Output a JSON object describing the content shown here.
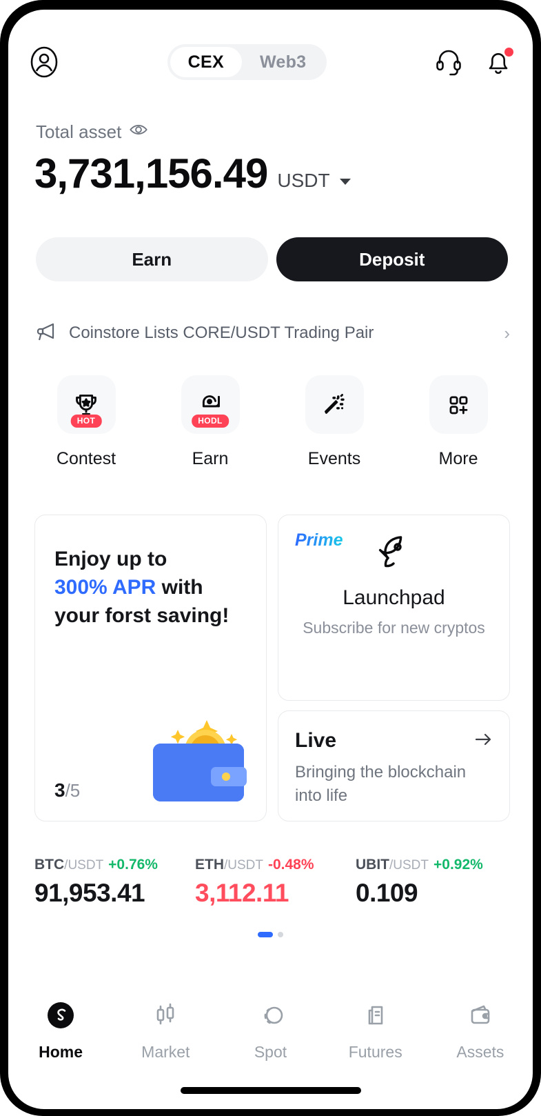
{
  "header": {
    "profile_icon": "user-circle-icon",
    "tabs": [
      {
        "label": "CEX",
        "active": true
      },
      {
        "label": "Web3",
        "active": false
      }
    ],
    "support_icon": "headset-icon",
    "notification_icon": "bell-icon",
    "has_notification": true
  },
  "balance": {
    "label": "Total asset",
    "eye_icon": "eye-icon",
    "amount": "3,731,156.49",
    "currency": "USDT",
    "caret_icon": "chevron-down-icon"
  },
  "actions": {
    "earn_label": "Earn",
    "deposit_label": "Deposit"
  },
  "announcement": {
    "icon": "megaphone-icon",
    "text": "Coinstore Lists CORE/USDT Trading Pair",
    "chevron": "›"
  },
  "quick_actions": [
    {
      "label": "Contest",
      "icon": "trophy-icon",
      "badge": "HOT"
    },
    {
      "label": "Earn",
      "icon": "piggy-coin-icon",
      "badge": "HODL"
    },
    {
      "label": "Events",
      "icon": "confetti-icon",
      "badge": ""
    },
    {
      "label": "More",
      "icon": "grid-plus-icon",
      "badge": ""
    }
  ],
  "promo": {
    "saving_card": {
      "line1": "Enjoy up to",
      "highlight": "300% APR",
      "line2_rest": " with",
      "line3": "your forst saving!",
      "counter_current": "3",
      "counter_total": "/5",
      "art_icon": "wallet-bitcoin-icon"
    },
    "prime_card": {
      "tag": "Prime",
      "icon": "rocket-icon",
      "title": "Launchpad",
      "subtitle": "Subscribe for new cryptos"
    },
    "live_card": {
      "title": "Live",
      "arrow_icon": "arrow-right-icon",
      "subtitle": "Bringing the blockchain into life"
    }
  },
  "tickers": [
    {
      "base": "BTC",
      "quote": "/USDT",
      "change": "+0.76%",
      "direction": "up",
      "price": "91,953.41",
      "price_negative": false
    },
    {
      "base": "ETH",
      "quote": "/USDT",
      "change": "-0.48%",
      "direction": "down",
      "price": "3,112.11",
      "price_negative": true
    },
    {
      "base": "UBIT",
      "quote": "/USDT",
      "change": "+0.92%",
      "direction": "up",
      "price": "0.109",
      "price_negative": false
    }
  ],
  "carousel_dots": {
    "active_index": 0,
    "count": 2
  },
  "bottom_nav": [
    {
      "label": "Home",
      "icon": "home-logo-icon",
      "active": true
    },
    {
      "label": "Market",
      "icon": "candlestick-icon",
      "active": false
    },
    {
      "label": "Spot",
      "icon": "swap-circles-icon",
      "active": false
    },
    {
      "label": "Futures",
      "icon": "document-chart-icon",
      "active": false
    },
    {
      "label": "Assets",
      "icon": "wallet-icon",
      "active": false
    }
  ],
  "colors": {
    "accent_blue": "#2f6bff",
    "up_green": "#14b86b",
    "down_red": "#ff4357",
    "badge_red": "#ff4357",
    "dark": "#16181d"
  }
}
